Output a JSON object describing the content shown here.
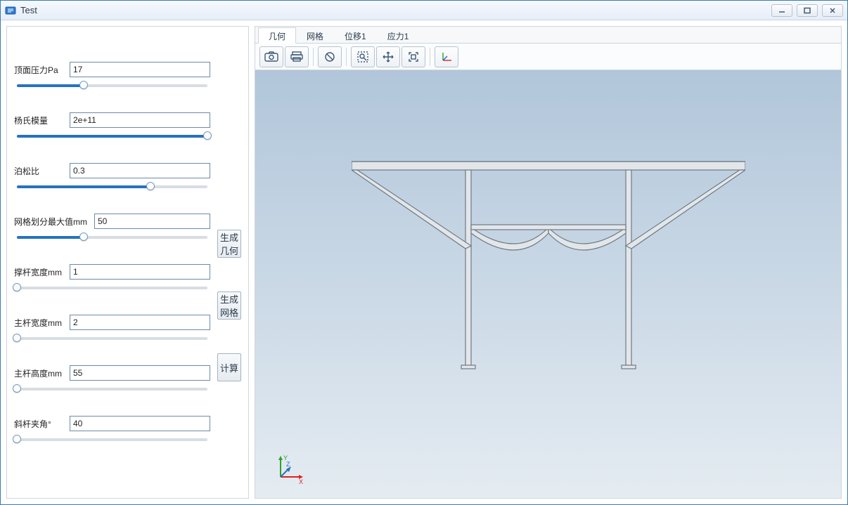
{
  "window": {
    "title": "Test"
  },
  "params": [
    {
      "label": "顶面压力Pa",
      "value": "17",
      "slider_pct": 35
    },
    {
      "label": "杨氏模量",
      "value": "2e+11",
      "slider_pct": 100
    },
    {
      "label": "泊松比",
      "value": "0.3",
      "slider_pct": 70
    },
    {
      "label": "网格划分最大值mm",
      "value": "50",
      "slider_pct": 35,
      "label_wide": true
    },
    {
      "label": "撑杆宽度mm",
      "value": "1",
      "slider_pct": 0
    },
    {
      "label": "主杆宽度mm",
      "value": "2",
      "slider_pct": 0
    },
    {
      "label": "主杆高度mm",
      "value": "55",
      "slider_pct": 0
    },
    {
      "label": "斜杆夹角°",
      "value": "40",
      "slider_pct": 0
    }
  ],
  "buttons": {
    "generate_geometry": "生成几何",
    "generate_mesh": "生成网格",
    "compute": "计算"
  },
  "tabs": [
    {
      "label": "几何",
      "active": true
    },
    {
      "label": "网格",
      "active": false
    },
    {
      "label": "位移1",
      "active": false
    },
    {
      "label": "应力1",
      "active": false
    }
  ],
  "axes": {
    "x": "X",
    "y": "Y",
    "z": "Z"
  }
}
